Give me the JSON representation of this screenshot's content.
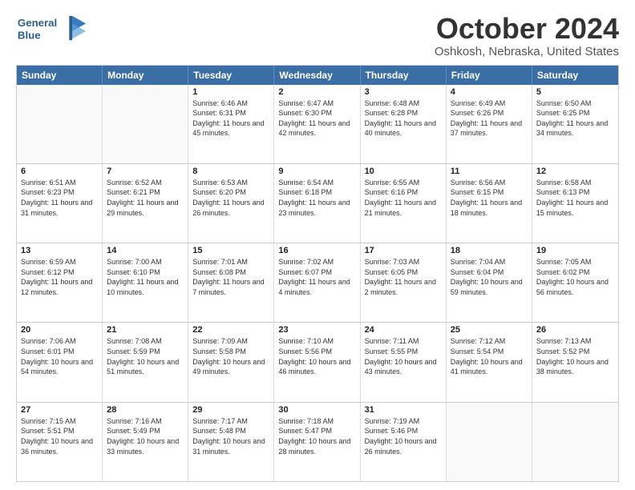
{
  "header": {
    "logo_general": "General",
    "logo_blue": "Blue",
    "month_title": "October 2024",
    "location": "Oshkosh, Nebraska, United States"
  },
  "weekdays": [
    "Sunday",
    "Monday",
    "Tuesday",
    "Wednesday",
    "Thursday",
    "Friday",
    "Saturday"
  ],
  "weeks": [
    [
      {
        "day": "",
        "info": ""
      },
      {
        "day": "",
        "info": ""
      },
      {
        "day": "1",
        "sunrise": "6:46 AM",
        "sunset": "6:31 PM",
        "daylight": "11 hours and 45 minutes."
      },
      {
        "day": "2",
        "sunrise": "6:47 AM",
        "sunset": "6:30 PM",
        "daylight": "11 hours and 42 minutes."
      },
      {
        "day": "3",
        "sunrise": "6:48 AM",
        "sunset": "6:28 PM",
        "daylight": "11 hours and 40 minutes."
      },
      {
        "day": "4",
        "sunrise": "6:49 AM",
        "sunset": "6:26 PM",
        "daylight": "11 hours and 37 minutes."
      },
      {
        "day": "5",
        "sunrise": "6:50 AM",
        "sunset": "6:25 PM",
        "daylight": "11 hours and 34 minutes."
      }
    ],
    [
      {
        "day": "6",
        "sunrise": "6:51 AM",
        "sunset": "6:23 PM",
        "daylight": "11 hours and 31 minutes."
      },
      {
        "day": "7",
        "sunrise": "6:52 AM",
        "sunset": "6:21 PM",
        "daylight": "11 hours and 29 minutes."
      },
      {
        "day": "8",
        "sunrise": "6:53 AM",
        "sunset": "6:20 PM",
        "daylight": "11 hours and 26 minutes."
      },
      {
        "day": "9",
        "sunrise": "6:54 AM",
        "sunset": "6:18 PM",
        "daylight": "11 hours and 23 minutes."
      },
      {
        "day": "10",
        "sunrise": "6:55 AM",
        "sunset": "6:16 PM",
        "daylight": "11 hours and 21 minutes."
      },
      {
        "day": "11",
        "sunrise": "6:56 AM",
        "sunset": "6:15 PM",
        "daylight": "11 hours and 18 minutes."
      },
      {
        "day": "12",
        "sunrise": "6:58 AM",
        "sunset": "6:13 PM",
        "daylight": "11 hours and 15 minutes."
      }
    ],
    [
      {
        "day": "13",
        "sunrise": "6:59 AM",
        "sunset": "6:12 PM",
        "daylight": "11 hours and 12 minutes."
      },
      {
        "day": "14",
        "sunrise": "7:00 AM",
        "sunset": "6:10 PM",
        "daylight": "11 hours and 10 minutes."
      },
      {
        "day": "15",
        "sunrise": "7:01 AM",
        "sunset": "6:08 PM",
        "daylight": "11 hours and 7 minutes."
      },
      {
        "day": "16",
        "sunrise": "7:02 AM",
        "sunset": "6:07 PM",
        "daylight": "11 hours and 4 minutes."
      },
      {
        "day": "17",
        "sunrise": "7:03 AM",
        "sunset": "6:05 PM",
        "daylight": "11 hours and 2 minutes."
      },
      {
        "day": "18",
        "sunrise": "7:04 AM",
        "sunset": "6:04 PM",
        "daylight": "10 hours and 59 minutes."
      },
      {
        "day": "19",
        "sunrise": "7:05 AM",
        "sunset": "6:02 PM",
        "daylight": "10 hours and 56 minutes."
      }
    ],
    [
      {
        "day": "20",
        "sunrise": "7:06 AM",
        "sunset": "6:01 PM",
        "daylight": "10 hours and 54 minutes."
      },
      {
        "day": "21",
        "sunrise": "7:08 AM",
        "sunset": "5:59 PM",
        "daylight": "10 hours and 51 minutes."
      },
      {
        "day": "22",
        "sunrise": "7:09 AM",
        "sunset": "5:58 PM",
        "daylight": "10 hours and 49 minutes."
      },
      {
        "day": "23",
        "sunrise": "7:10 AM",
        "sunset": "5:56 PM",
        "daylight": "10 hours and 46 minutes."
      },
      {
        "day": "24",
        "sunrise": "7:11 AM",
        "sunset": "5:55 PM",
        "daylight": "10 hours and 43 minutes."
      },
      {
        "day": "25",
        "sunrise": "7:12 AM",
        "sunset": "5:54 PM",
        "daylight": "10 hours and 41 minutes."
      },
      {
        "day": "26",
        "sunrise": "7:13 AM",
        "sunset": "5:52 PM",
        "daylight": "10 hours and 38 minutes."
      }
    ],
    [
      {
        "day": "27",
        "sunrise": "7:15 AM",
        "sunset": "5:51 PM",
        "daylight": "10 hours and 36 minutes."
      },
      {
        "day": "28",
        "sunrise": "7:16 AM",
        "sunset": "5:49 PM",
        "daylight": "10 hours and 33 minutes."
      },
      {
        "day": "29",
        "sunrise": "7:17 AM",
        "sunset": "5:48 PM",
        "daylight": "10 hours and 31 minutes."
      },
      {
        "day": "30",
        "sunrise": "7:18 AM",
        "sunset": "5:47 PM",
        "daylight": "10 hours and 28 minutes."
      },
      {
        "day": "31",
        "sunrise": "7:19 AM",
        "sunset": "5:46 PM",
        "daylight": "10 hours and 26 minutes."
      },
      {
        "day": "",
        "info": ""
      },
      {
        "day": "",
        "info": ""
      }
    ]
  ]
}
